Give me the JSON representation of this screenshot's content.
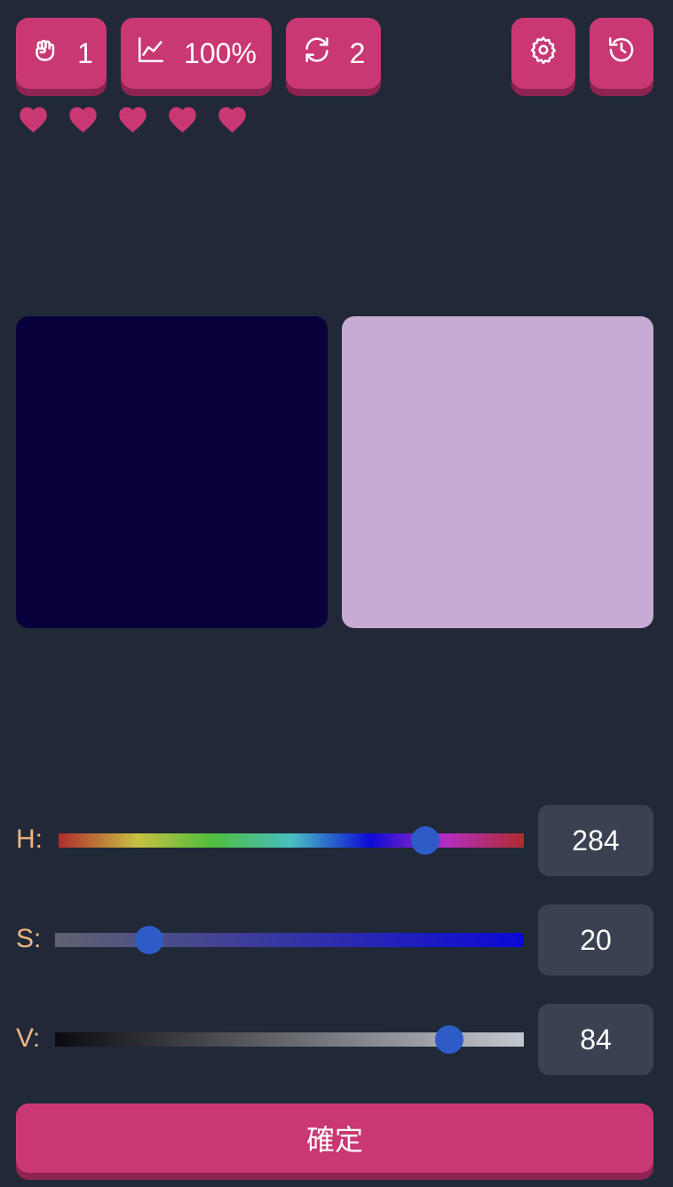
{
  "stats": {
    "attempts": "1",
    "accuracy": "100%",
    "retries": "2"
  },
  "icons": [
    "fist-icon",
    "chart-line-icon",
    "refresh-icon",
    "gear-icon",
    "history-icon",
    "heart-icon"
  ],
  "lives": {
    "count": 5,
    "color": "#c93872"
  },
  "swatches": {
    "target_color": "#08003a",
    "current_color": "#c7abd4"
  },
  "hsv": {
    "h": {
      "label": "H:",
      "value": "284",
      "max": 360
    },
    "s": {
      "label": "S:",
      "value": "20",
      "max": 100
    },
    "v": {
      "label": "V:",
      "value": "84",
      "max": 100
    }
  },
  "confirm_label": "確定",
  "colors": {
    "background": "#212838",
    "accent": "#c93872",
    "knob": "#2d5cc7",
    "label": "#f0b681",
    "value_box": "#3a4150"
  }
}
